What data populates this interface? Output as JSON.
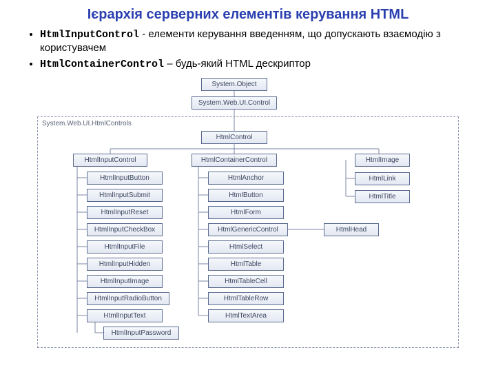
{
  "title": "Ієрархія серверних елементів керування HTML",
  "bullets": [
    {
      "code": "HtmlInputControl",
      "sep": " - ",
      "text": "елементи керування введенням, що допускають взаємодію з користувачем"
    },
    {
      "code": "HtmlContainerControl",
      "sep": " – ",
      "text": "будь-який HTML дескриптор"
    }
  ],
  "namespace": "System.Web.UI.HtmlControls",
  "nodes": {
    "object": "System.Object",
    "control": "System.Web.UI.Control",
    "htmlcontrol": "HtmlControl",
    "inputcontrol": "HtmlInputControl",
    "containercontrol": "HtmlContainerControl",
    "image": "HtmlImage",
    "link": "HtmlLink",
    "titlebox": "HtmlTitle",
    "inputbutton": "HtmlInputButton",
    "inputsubmit": "HtmlInputSubmit",
    "inputreset": "HtmlInputReset",
    "inputcheckbox": "HtmlInputCheckBox",
    "inputfile": "HtmlInputFile",
    "inputhidden": "HtmlInputHidden",
    "inputimage": "HtmlInputImage",
    "inputradio": "HtmlInputRadioButton",
    "inputtext": "HtmlInputText",
    "inputpassword": "HtmlInputPassword",
    "anchor": "HtmlAnchor",
    "button": "HtmlButton",
    "form": "HtmlForm",
    "generic": "HtmlGenericControl",
    "select": "HtmlSelect",
    "table": "HtmlTable",
    "tablecell": "HtmlTableCell",
    "tablerow": "HtmlTableRow",
    "textarea": "HtmlTextArea",
    "head": "HtmlHead"
  }
}
